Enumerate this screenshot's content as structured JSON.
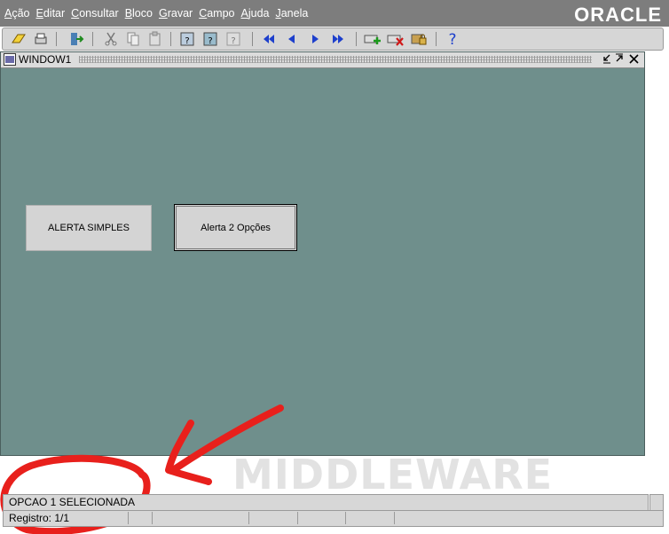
{
  "menu": {
    "items": [
      "Ação",
      "Editar",
      "Consultar",
      "Bloco",
      "Gravar",
      "Campo",
      "Ajuda",
      "Janela"
    ],
    "logo": "ORACLE"
  },
  "toolbar": {
    "icons": [
      "save-icon",
      "print-icon",
      "exit-icon",
      "cut-icon",
      "copy-icon",
      "paste-icon",
      "enter-query-icon",
      "execute-query-icon",
      "cancel-query-icon",
      "previous-block-icon",
      "previous-record-icon",
      "next-record-icon",
      "next-block-icon",
      "insert-record-icon",
      "delete-record-icon",
      "lock-record-icon",
      "help-icon"
    ]
  },
  "window": {
    "title": "WINDOW1",
    "buttons": {
      "alert_simple": "ALERTA SIMPLES",
      "alert_two_options": "Alerta 2 Opções"
    }
  },
  "watermark": "MIDDLEWARE",
  "status": {
    "message": "OPCAO 1 SELECIONADA",
    "record": "Registro: 1/1"
  },
  "colors": {
    "canvas": "#6f8f8c",
    "menubar": "#7d7d7d",
    "annotation": "#e8201c"
  }
}
